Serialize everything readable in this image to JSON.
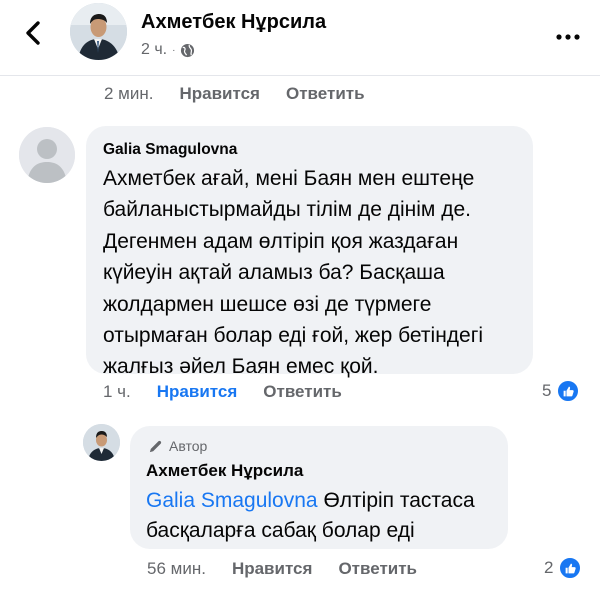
{
  "header": {
    "author_name": "Ахметбек Нұрсила",
    "time": "2 ч.",
    "separator": "·",
    "back_icon": "chevron-left-icon",
    "privacy_icon": "globe-icon",
    "more_icon": "more-horizontal-icon"
  },
  "prev_comment_actions": {
    "time": "2 мин.",
    "like": "Нравится",
    "reply": "Ответить"
  },
  "comment": {
    "author": "Galia Smagulovna",
    "text": "Ахметбек ағай, мені Баян мен ештеңе байланыстырмайды тілім де дінім де. Дегенмен адам өлтіріп қоя жаздаған күйеуін ақтай аламыз ба? Басқаша жолдармен шешсе өзі де түрмеге отырмаған болар еді ғой, жер бетіндегі жалғыз әйел Баян емес қой.",
    "time": "1 ч.",
    "like": "Нравится",
    "reply": "Ответить",
    "reaction_count": "5",
    "like_color": "#1877f2"
  },
  "reply": {
    "badge": "Автор",
    "author": "Ахметбек Нұрсила",
    "mention": "Galia Smagulovna",
    "text": " Өлтіріп тастаса басқаларға сабақ болар еді",
    "time": "56 мин.",
    "like": "Нравится",
    "reply": "Ответить",
    "reaction_count": "2"
  }
}
